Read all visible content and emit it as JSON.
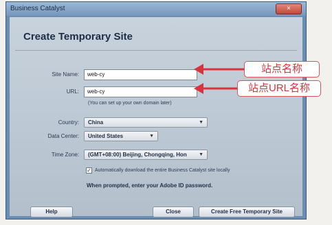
{
  "window": {
    "title": "Business Catalyst",
    "close_glyph": "×"
  },
  "dialog": {
    "heading": "Create Temporary Site",
    "site_name": {
      "label": "Site Name:",
      "value": "web-cy"
    },
    "url": {
      "label": "URL:",
      "value": "web-cy",
      "hint": "(You can set up your own domain later)"
    },
    "country": {
      "label": "Country:",
      "value": "China"
    },
    "data_center": {
      "label": "Data Center:",
      "value": "United States"
    },
    "time_zone": {
      "label": "Time Zone:",
      "value": "(GMT+08:00) Beijing, Chongqing, Hon"
    },
    "auto_download": {
      "checked": true,
      "label": "Automatically download the entire Business Catalyst site locally"
    },
    "prompt_note": "When prompted, enter your Adobe ID password.",
    "buttons": {
      "help": "Help",
      "close": "Close",
      "create": "Create Free Temporary Site"
    }
  },
  "annotations": {
    "site_name": "站点名称",
    "site_url": "站点URL名称",
    "color": "#d6343e"
  }
}
